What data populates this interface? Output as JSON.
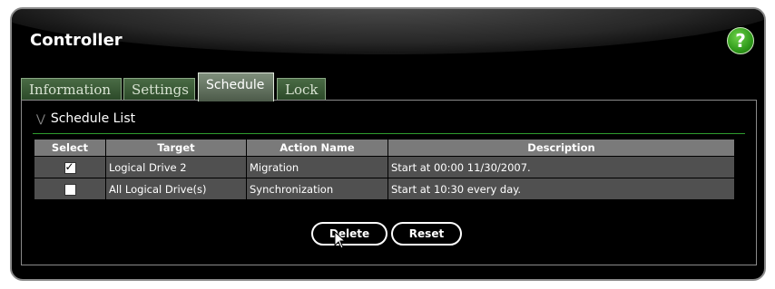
{
  "window": {
    "title": "Controller",
    "help_label": "?"
  },
  "tabs": [
    {
      "label": "Information",
      "active": false
    },
    {
      "label": "Settings",
      "active": false
    },
    {
      "label": "Schedule",
      "active": true
    },
    {
      "label": "Lock",
      "active": false
    }
  ],
  "section": {
    "title": "Schedule List"
  },
  "table": {
    "columns": [
      "Select",
      "Target",
      "Action Name",
      "Description"
    ],
    "rows": [
      {
        "selected": true,
        "target": "Logical Drive 2",
        "action": "Migration",
        "description": "Start at 00:00 11/30/2007."
      },
      {
        "selected": false,
        "target": "All Logical Drive(s)",
        "action": "Synchronization",
        "description": "Start at 10:30 every day."
      }
    ]
  },
  "buttons": {
    "delete": "Delete",
    "reset": "Reset"
  },
  "colors": {
    "accent_green": "#2e9c2e",
    "tab_green": "#3b5a37",
    "help_green": "#2f9a1a"
  },
  "icons": [
    "help-icon",
    "chevron-down-icon",
    "checkbox-checked-icon",
    "checkbox-unchecked-icon",
    "mouse-pointer-icon"
  ]
}
